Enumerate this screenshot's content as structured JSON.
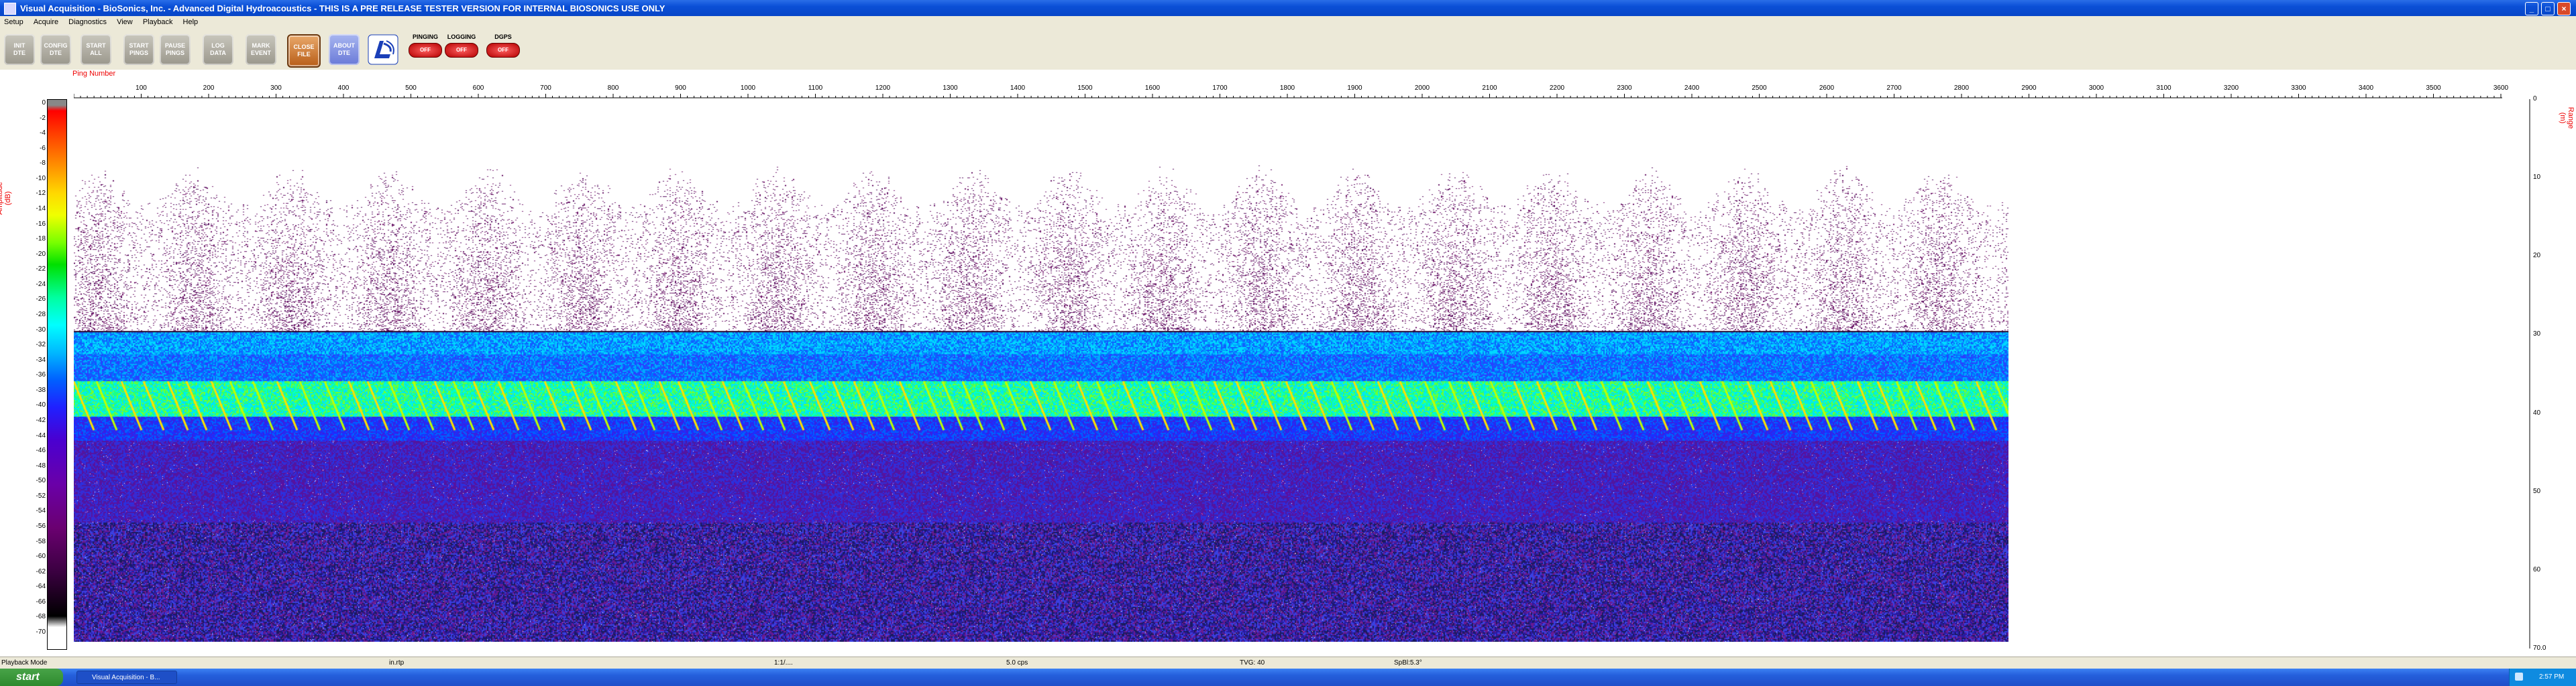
{
  "window": {
    "title": "Visual Acquisition - BioSonics, Inc. - Advanced Digital Hydroacoustics - THIS IS A PRE RELEASE TESTER VERSION FOR INTERNAL BIOSONICS USE ONLY",
    "min_label": "_",
    "max_label": "□",
    "close_label": "×"
  },
  "menu": [
    "Setup",
    "Acquire",
    "Diagnostics",
    "View",
    "Playback",
    "Help"
  ],
  "toolbar": {
    "buttons": [
      {
        "name": "init-dte-button",
        "label": "INIT\nDTE",
        "style": "gray"
      },
      {
        "name": "config-dte-button",
        "label": "CONFIG\nDTE",
        "style": "gray"
      },
      {
        "name": "start-all-button",
        "label": "START\nALL",
        "style": "gray"
      },
      {
        "name": "start-pings-button",
        "label": "START\nPINGS",
        "style": "gray"
      },
      {
        "name": "pause-pings-button",
        "label": "PAUSE\nPINGS",
        "style": "gray"
      },
      {
        "name": "log-data-button",
        "label": "LOG\nDATA",
        "style": "gray"
      },
      {
        "name": "mark-event-button",
        "label": "MARK\nEVENT",
        "style": "gray"
      },
      {
        "name": "close-file-button",
        "label": "CLOSE\nFILE",
        "style": "orange"
      },
      {
        "name": "about-dte-button",
        "label": "ABOUT\nDTE",
        "style": "blue"
      }
    ],
    "status": [
      {
        "name": "pinging-indicator",
        "label": "PINGING",
        "value": "OFF"
      },
      {
        "name": "logging-indicator",
        "label": "LOGGING",
        "value": "OFF"
      },
      {
        "name": "dgps-indicator",
        "label": "DGPS",
        "value": "OFF"
      }
    ]
  },
  "echogram": {
    "x_axis_label": "Ping Number",
    "x_ticks": [
      "100",
      "200",
      "300",
      "400",
      "500",
      "600",
      "700",
      "800",
      "900",
      "1000",
      "1100",
      "1200",
      "1300",
      "1400",
      "1500",
      "1600",
      "1700",
      "1800",
      "1900",
      "2000",
      "2100",
      "2200",
      "2300",
      "2400",
      "2500",
      "2600",
      "2700",
      "2800",
      "2900",
      "3000",
      "3100",
      "3200",
      "3300",
      "3400",
      "3500",
      "3600"
    ],
    "left_axis_label": "Amplitude (dB)",
    "colorbar_ticks": [
      "0",
      "-2",
      "-4",
      "-6",
      "-8",
      "-10",
      "-12",
      "-14",
      "-16",
      "-18",
      "-20",
      "-22",
      "-24",
      "-26",
      "-28",
      "-30",
      "-32",
      "-34",
      "-36",
      "-38",
      "-40",
      "-42",
      "-44",
      "-46",
      "-48",
      "-50",
      "-52",
      "-54",
      "-56",
      "-58",
      "-60",
      "-62",
      "-64",
      "-66",
      "-68",
      "-70"
    ],
    "right_axis_label": "Range (m)",
    "right_ticks": [
      "0",
      "10",
      "20",
      "30",
      "40",
      "50",
      "60",
      "70.0"
    ],
    "pings_recorded": 2880
  },
  "statusbar": [
    "Playback Mode",
    "in.rtp",
    "1:1/....",
    "5.0 cps",
    "TVG: 40",
    "SpBl:5.3°"
  ],
  "taskbar": {
    "start_label": "start",
    "task_label": "Visual Acquisition - B...",
    "clock": "2:57 PM"
  }
}
